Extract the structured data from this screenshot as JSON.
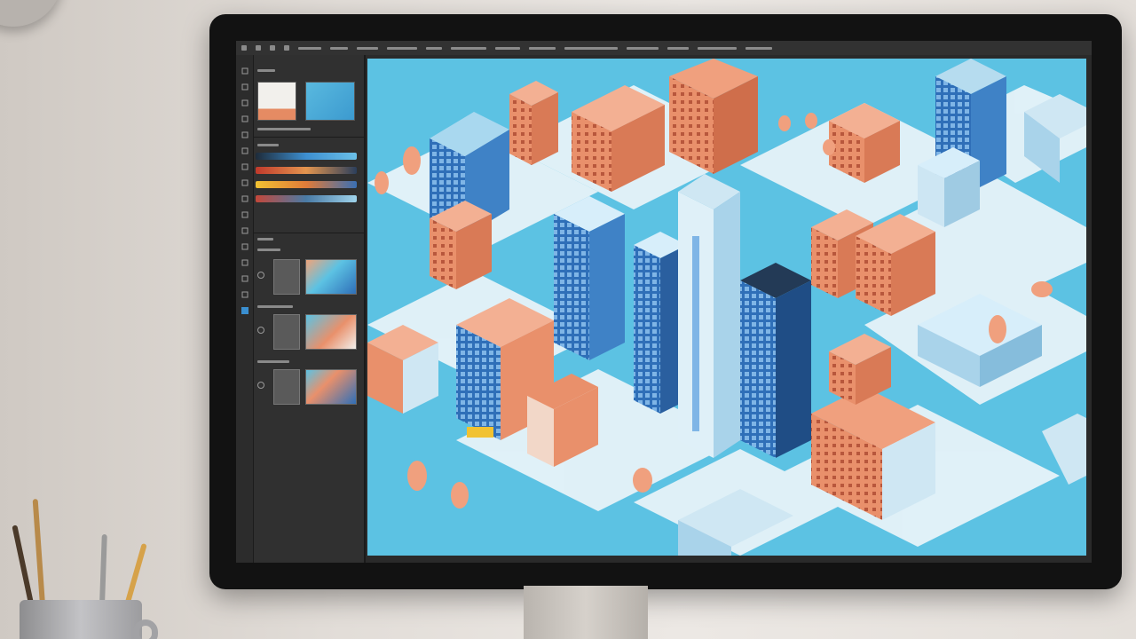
{
  "colors": {
    "canvas_water": "#5cc2e3",
    "building_blue": "#2f6fb8",
    "building_coral": "#e9906b",
    "app_panel": "#303030",
    "bezel": "#121212"
  },
  "app": {
    "menu_icons": [
      "home-icon",
      "document-icon",
      "arrow-icon",
      "layers-icon"
    ],
    "tools": [
      "move-icon",
      "marquee-icon",
      "lasso-icon",
      "crop-icon",
      "eyedropper-icon",
      "brush-icon",
      "stamp-icon",
      "eraser-icon",
      "gradient-icon",
      "blur-icon",
      "pen-icon",
      "text-icon",
      "shape-icon",
      "hand-icon",
      "zoom-icon",
      "color-swatch-icon"
    ]
  },
  "panels": {
    "gradients": [
      {
        "colors": [
          "#1e2b3a",
          "#3d8fd0",
          "#6bc0e8"
        ]
      },
      {
        "colors": [
          "#c0392b",
          "#e3954f",
          "#2b3f5c"
        ]
      },
      {
        "colors": [
          "#f1c232",
          "#e07b39",
          "#3a6fb3"
        ]
      },
      {
        "colors": [
          "#c4473a",
          "#4a7ba6",
          "#9fd3ea"
        ]
      }
    ]
  }
}
